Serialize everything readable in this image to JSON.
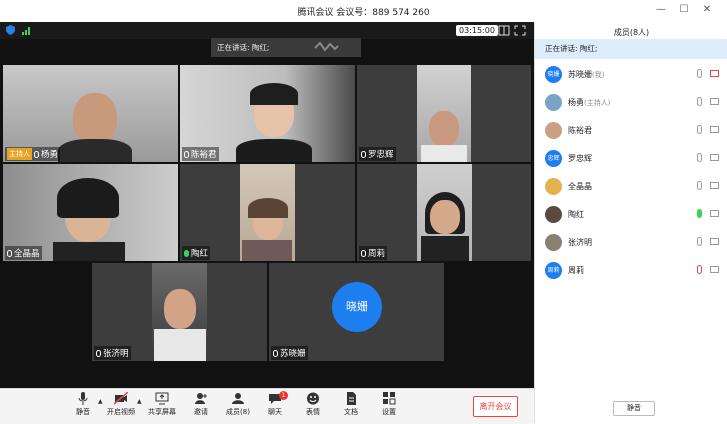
{
  "window": {
    "title": "腾讯会议  会议号：889 574 260",
    "minimize": "—",
    "maximize": "☐",
    "close": "✕"
  },
  "topbar": {
    "timer": "03:15:00",
    "speaking": "正在讲话: 陶红;"
  },
  "tiles": [
    {
      "name": "杨勇",
      "host_badge": "主持人",
      "mic": "normal"
    },
    {
      "name": "陈裕君",
      "mic": "normal"
    },
    {
      "name": "罗忠辉",
      "mic": "normal"
    },
    {
      "name": "全晶晶",
      "mic": "normal"
    },
    {
      "name": "陶红",
      "mic": "green"
    },
    {
      "name": "周莉",
      "mic": "normal"
    },
    {
      "name": "张济明",
      "mic": "normal"
    },
    {
      "name": "苏晓姗",
      "mic": "normal",
      "avatar_text": "晓姗"
    }
  ],
  "toolbar": {
    "mute": "静音",
    "video": "开启视频",
    "share": "共享屏幕",
    "invite": "邀请",
    "members": "成员(8)",
    "chat": "聊天",
    "chat_badge": "1",
    "emoji": "表情",
    "docs": "文档",
    "settings": "设置",
    "leave": "离开会议"
  },
  "sidebar": {
    "title": "成员(8人)",
    "speaking": "正在讲话: 陶红;",
    "mute_all": "静音",
    "members": [
      {
        "name": "苏晓姗",
        "role": "(我)",
        "avatar": "晓姗",
        "color": "#1d7ef0",
        "mic": "normal",
        "cam": "off"
      },
      {
        "name": "杨勇",
        "role": "(主持人)",
        "avatar": "",
        "color": "#7aa3c7",
        "mic": "normal",
        "cam": "normal"
      },
      {
        "name": "陈裕君",
        "role": "",
        "avatar": "",
        "color": "#c9a080",
        "mic": "normal",
        "cam": "normal"
      },
      {
        "name": "罗忠辉",
        "role": "",
        "avatar": "忠辉",
        "color": "#1d7ef0",
        "mic": "normal",
        "cam": "normal"
      },
      {
        "name": "全晶晶",
        "role": "",
        "avatar": "",
        "color": "#e3b24f",
        "mic": "normal",
        "cam": "normal"
      },
      {
        "name": "陶红",
        "role": "",
        "avatar": "",
        "color": "#5a4a40",
        "mic": "green",
        "cam": "normal"
      },
      {
        "name": "张济明",
        "role": "",
        "avatar": "",
        "color": "#8a8070",
        "mic": "normal",
        "cam": "normal"
      },
      {
        "name": "周莉",
        "role": "",
        "avatar": "周莉",
        "color": "#1d7ef0",
        "mic": "muted",
        "cam": "normal"
      }
    ]
  }
}
